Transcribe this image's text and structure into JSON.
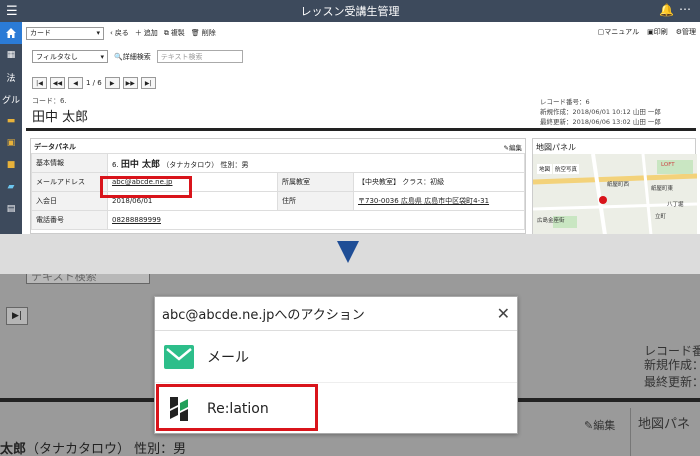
{
  "app": {
    "title": "レッスン受講生管理"
  },
  "sidebar": {
    "items": [
      "法",
      "グル"
    ]
  },
  "toolbar": {
    "view_select": "カード",
    "back": "戻る",
    "add": "追加",
    "copy": "複製",
    "delete": "削除",
    "manual": "マニュアル",
    "print": "印刷",
    "manage": "管理"
  },
  "filter": {
    "select": "フィルタなし",
    "detail_search": "詳細検索",
    "text_search_placeholder": "テキスト検索"
  },
  "pager": {
    "position": "1 / 6"
  },
  "record": {
    "code_label": "コード：6.",
    "name": "田中 太郎",
    "record_no": "レコード番号：6",
    "created": "新規作成：2018/06/01 10:12 山田 一郎",
    "updated": "最終更新：2018/06/06 13:02 山田 一郎"
  },
  "datapanel": {
    "title": "データパネル",
    "edit": "編集",
    "rows": {
      "basic_label": "基本情報",
      "basic_no": "6.",
      "basic_name": "田中 太郎",
      "basic_kana": "（タナカタロウ）",
      "basic_gender": "性別：男",
      "email_label": "メールアドレス",
      "email_value": "abc@abcde.ne.jp",
      "school_label": "所属教室",
      "school_value": "【中央教室】 クラス：初級",
      "join_label": "入会日",
      "join_value": "2018/06/01",
      "address_label": "住所",
      "address_value": "〒730-0036 広島県 広島市中区袋町4-31",
      "phone_label": "電話番号",
      "phone_value": "08288889999"
    }
  },
  "mappanel": {
    "title": "地図パネル",
    "labels": [
      "地図",
      "航空写真",
      "LOFT",
      "紙屋町西",
      "紙屋町東",
      "立町",
      "八丁堀",
      "広島金座街"
    ]
  },
  "zoom": {
    "textbox": "テキスト検索",
    "meta1": "レコード番",
    "meta2": "新規作成：",
    "meta3": "最終更新：",
    "edit": "編集",
    "map_title": "地図パネ",
    "name_bold": "太郎",
    "name_rest": "（タナカタロウ） 性別：男"
  },
  "popup": {
    "title": "abc@abcde.ne.jpへのアクション",
    "items": [
      {
        "label": "メール"
      },
      {
        "label": "Re:lation"
      }
    ]
  },
  "colors": {
    "titlebar": "#3d4a5c",
    "accent": "#2b7bd6",
    "highlight": "#d9141b",
    "arrow": "#1f4e96",
    "mail_green": "#2dbe8a"
  }
}
